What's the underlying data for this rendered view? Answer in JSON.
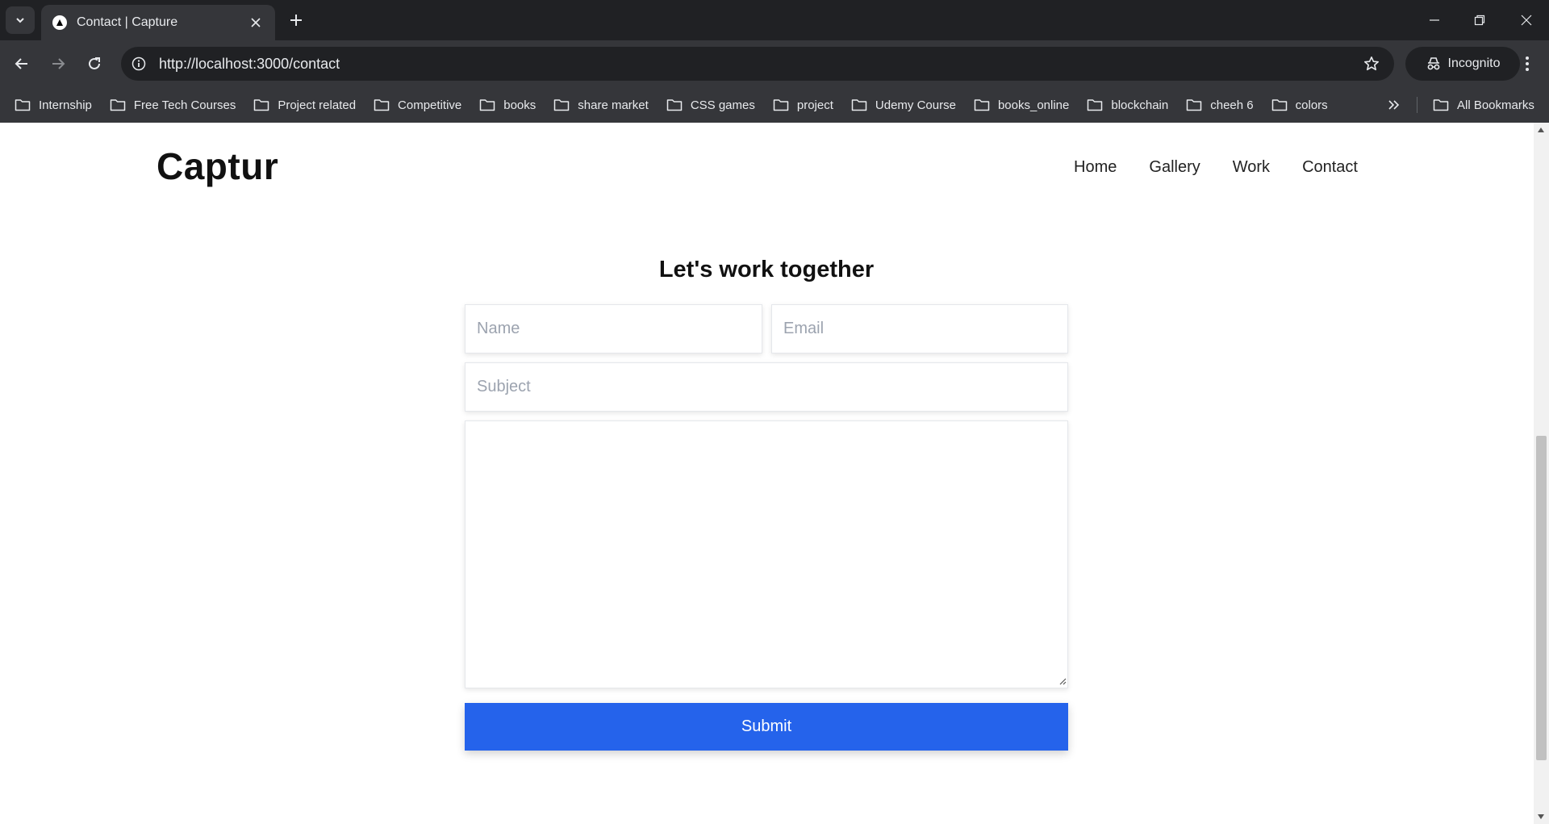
{
  "browser": {
    "tab_title": "Contact | Capture",
    "url": "http://localhost:3000/contact",
    "incognito_label": "Incognito",
    "bookmarks": [
      "Internship",
      "Free Tech Courses",
      "Project related",
      "Competitive",
      "books",
      "share market",
      "CSS games",
      "project",
      "Udemy Course",
      "books_online",
      "blockchain",
      "cheeh 6",
      "colors"
    ],
    "all_bookmarks_label": "All Bookmarks"
  },
  "site": {
    "logo": "Captur",
    "nav": [
      "Home",
      "Gallery",
      "Work",
      "Contact"
    ]
  },
  "contact": {
    "heading": "Let's work together",
    "name_placeholder": "Name",
    "email_placeholder": "Email",
    "subject_placeholder": "Subject",
    "message_value": "",
    "submit_label": "Submit"
  },
  "colors": {
    "accent": "#2563eb",
    "chrome_dark": "#202124",
    "chrome_mid": "#35363a"
  },
  "icons": {
    "tab_search": "chevron-down-icon",
    "favicon": "triangle-icon",
    "close": "close-icon",
    "new_tab": "plus-icon",
    "back": "arrow-left-icon",
    "forward": "arrow-right-icon",
    "reload": "reload-icon",
    "site_info": "info-icon",
    "bookmark_star": "star-icon",
    "incognito": "incognito-icon",
    "menu": "kebab-menu-icon",
    "folder": "folder-icon",
    "more": "double-chevron-right-icon"
  }
}
